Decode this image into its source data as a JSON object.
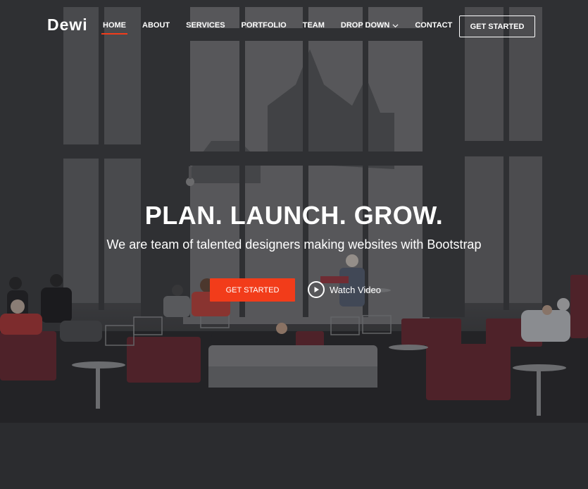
{
  "brand": {
    "logo": "Dewi",
    "accent": "#f23c1a"
  },
  "nav": {
    "items": [
      {
        "label": "HOME",
        "active": true
      },
      {
        "label": "ABOUT"
      },
      {
        "label": "SERVICES"
      },
      {
        "label": "PORTFOLIO"
      },
      {
        "label": "TEAM"
      },
      {
        "label": "DROP DOWN",
        "icon": "chevron-down-icon"
      },
      {
        "label": "CONTACT"
      }
    ],
    "cta_label": "GET STARTED"
  },
  "hero": {
    "title": "PLAN. LAUNCH. GROW.",
    "subtitle": "We are team of talented designers making websites with Bootstrap",
    "primary_button": "GET STARTED",
    "video_link": {
      "label": "Watch Video",
      "icon": "play-icon"
    }
  }
}
